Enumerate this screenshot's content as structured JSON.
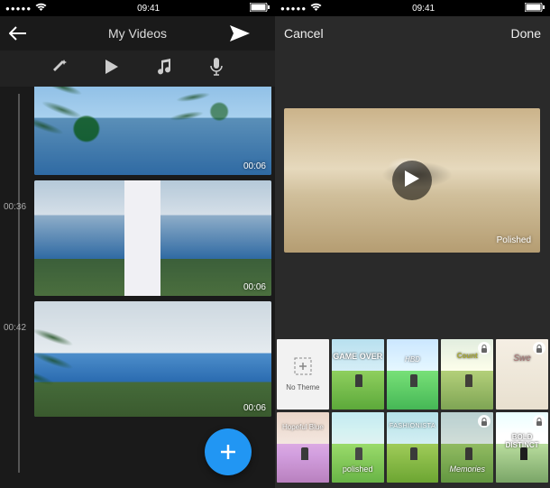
{
  "status": {
    "carrier_dots": "●●●●●",
    "wifi": "wifi",
    "time": "09:41",
    "battery": "battery"
  },
  "left": {
    "title": "My Videos",
    "toolbar": {
      "effects": "effects",
      "play": "play",
      "music": "music",
      "mic": "mic"
    },
    "timeline": {
      "labels": {
        "t1": "00:36",
        "t2": "00:42"
      },
      "clips": [
        {
          "duration": "00:06"
        },
        {
          "duration": "00:06"
        },
        {
          "duration": "00:06"
        }
      ]
    }
  },
  "right": {
    "cancel": "Cancel",
    "done": "Done",
    "preview": {
      "selected_theme": "Polished"
    },
    "themes": [
      {
        "label": "No Theme",
        "locked": false
      },
      {
        "label": "GAME OVER",
        "locked": false
      },
      {
        "label": "HBD",
        "locked": false
      },
      {
        "label": "Count",
        "locked": true
      },
      {
        "label": "Swe",
        "locked": true
      },
      {
        "label": "Hopeful Blue",
        "locked": false
      },
      {
        "label": "polished",
        "locked": false
      },
      {
        "label": "FASHIONISTA",
        "locked": false
      },
      {
        "label": "Memories",
        "locked": true
      },
      {
        "label": "BOLD DISTINCT",
        "locked": true
      }
    ]
  }
}
